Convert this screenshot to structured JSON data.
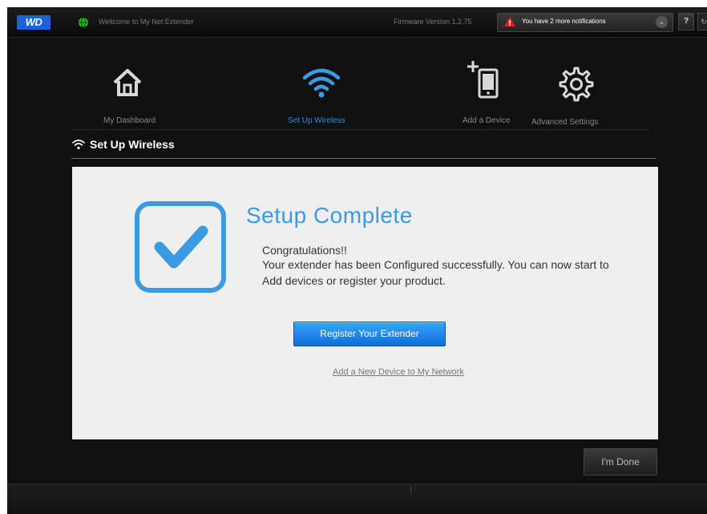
{
  "header": {
    "logo": "WD",
    "welcome": "Wellcome to My Net Extender",
    "firmware": "Firmware Version 1.2.75",
    "notification": "You have 2 more notifications",
    "help_label": "?",
    "icons": {
      "globe": "globe-icon",
      "warning": "warning-icon",
      "chevron": "chevron-down-icon",
      "power": "power-icon"
    }
  },
  "nav": {
    "items": [
      {
        "label": "My Dashboard",
        "icon": "home-icon",
        "active": false
      },
      {
        "label": "Set Up Wireless",
        "icon": "wifi-icon",
        "active": true
      },
      {
        "label": "Add a Device",
        "icon": "add-device-icon",
        "active": false
      },
      {
        "label": "Advanced Settings",
        "icon": "gear-icon",
        "active": false
      }
    ]
  },
  "section": {
    "title": "Set Up Wireless",
    "icon": "wifi-icon"
  },
  "card": {
    "title": "Setup Complete",
    "line1": "Congratulations!!",
    "body": "Your extender has been Configured successfully.  You can now start to Add devices or register your product.",
    "register_button": "Register Your  Extender",
    "add_link": "Add a New Device to My Network",
    "icon": "checkmark-icon"
  },
  "footer": {
    "done_button": "I'm Done"
  },
  "colors": {
    "accent": "#3a9be3",
    "button_blue": "#1a80e8",
    "background": "#101010",
    "card": "#efefef",
    "warning": "#e02020"
  }
}
